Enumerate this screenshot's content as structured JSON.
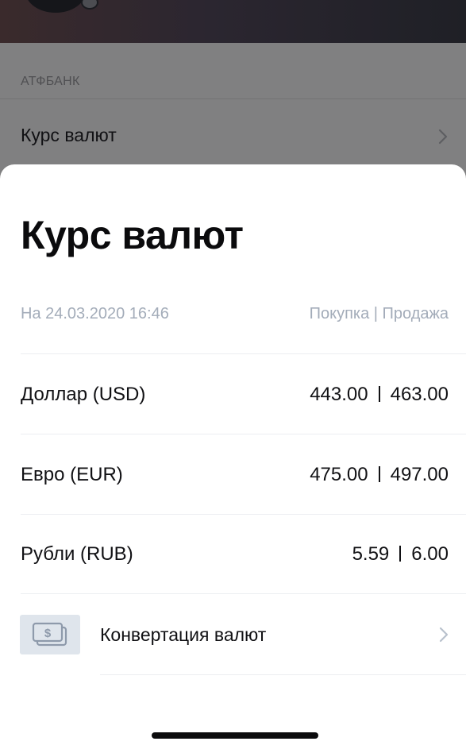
{
  "background": {
    "section_title": "АТФБАНК",
    "row_label": "Курс валют"
  },
  "sheet": {
    "title": "Курс валют",
    "date_label": "На 24.03.2020 16:46",
    "columns_label": "Покупка | Продажа",
    "rates": [
      {
        "name": "Доллар (USD)",
        "buy": "443.00",
        "sell": "463.00"
      },
      {
        "name": "Евро (EUR)",
        "buy": "475.00",
        "sell": "497.00"
      },
      {
        "name": "Рубли (RUB)",
        "buy": "5.59",
        "sell": "6.00"
      }
    ],
    "convert": {
      "label": "Конвертация валют",
      "icon": "money-convert-icon"
    }
  },
  "colors": {
    "accent_muted": "#a3acb9",
    "icon_bg": "#dfe5ec",
    "text": "#111114"
  }
}
